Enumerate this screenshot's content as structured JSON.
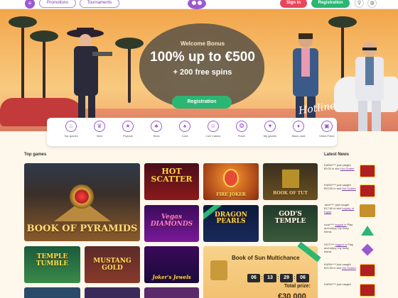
{
  "header": {
    "menu_icon": "hamburger-icon",
    "promotions": "Promotions",
    "tournaments": "Tournaments",
    "sign_in": "Sign in",
    "registration": "Registration",
    "search_icon": "search-icon",
    "language_icon": "globe-icon"
  },
  "hero": {
    "welcome": "Welcome Bonus",
    "headline": "100% up to €500",
    "subline": "+ 200 free spins",
    "cta": "Registration",
    "signature": "Hotline",
    "slides": 3,
    "active_slide": 1
  },
  "categories": [
    {
      "label": "Top games",
      "icon": "flame-icon",
      "glyph": "♨"
    },
    {
      "label": "New",
      "icon": "crown-icon",
      "glyph": "♛"
    },
    {
      "label": "Popular",
      "icon": "star-icon",
      "glyph": "★"
    },
    {
      "label": "Slots",
      "icon": "cherry-icon",
      "glyph": "♣"
    },
    {
      "label": "Card",
      "icon": "cards-icon",
      "glyph": "♠"
    },
    {
      "label": "Live Casino",
      "icon": "dealer-icon",
      "glyph": "☺"
    },
    {
      "label": "Poker",
      "icon": "chip-icon",
      "glyph": "✪"
    },
    {
      "label": "My games",
      "icon": "heart-icon",
      "glyph": "♥"
    },
    {
      "label": "Black Jack",
      "icon": "blackjack-icon",
      "glyph": "♦"
    },
    {
      "label": "Video Poker",
      "icon": "video-poker-icon",
      "glyph": "▣"
    }
  ],
  "sections": {
    "top_games": "Top games",
    "latest_news": "Latest News"
  },
  "games": [
    {
      "title": "BOOK OF PYRAMIDS"
    },
    {
      "title": "HOT SCATTER"
    },
    {
      "title": "FIRE JOKER"
    },
    {
      "title": "BOOK OF TUT"
    },
    {
      "title": "Vegas DIAMONDS"
    },
    {
      "title": "DRAGON PEARLS"
    },
    {
      "title": "GOD'S TEMPLE"
    },
    {
      "title": "TEMPLE TUMBLE"
    },
    {
      "title": "MUSTANG GOLD"
    },
    {
      "title": "Joker's Jewels"
    }
  ],
  "jackpot": {
    "title": "Book of Sun Multichance",
    "timer": [
      "06",
      "13",
      "29",
      "06"
    ],
    "prize_label": "Total prize:",
    "prize_value": "€30 000"
  },
  "news": [
    {
      "text": "KARA**** just caught €9.00 in slot ",
      "link": "Hot Scatter",
      "thumb": "red"
    },
    {
      "text": "KARA**** just caught €20.00 in slot ",
      "link": "Hot Scatter",
      "thumb": "red"
    },
    {
      "text": "Jane**** just caught €17.60 in slot ",
      "link": "Legacy of Egypt",
      "thumb": "gold"
    },
    {
      "text": "roos**** ",
      "link": "logged in",
      "text2": "Play and enjoy, my lucky friend.",
      "thumb": "tri"
    },
    {
      "text": "HOT**** ",
      "link": "logged in",
      "text2": "Play and enjoy, my lucky friend.",
      "thumb": "diamond"
    },
    {
      "text": "KARA**** just caught €20.00 in slot ",
      "link": "Hot Scatter",
      "thumb": "red"
    },
    {
      "text": "KARA**** just caught ",
      "link": "",
      "thumb": "red"
    }
  ],
  "colors": {
    "accent_purple": "#9b59d0",
    "signin_red": "#e8485a",
    "register_green": "#2bb673",
    "background": "#fdf7ec"
  }
}
